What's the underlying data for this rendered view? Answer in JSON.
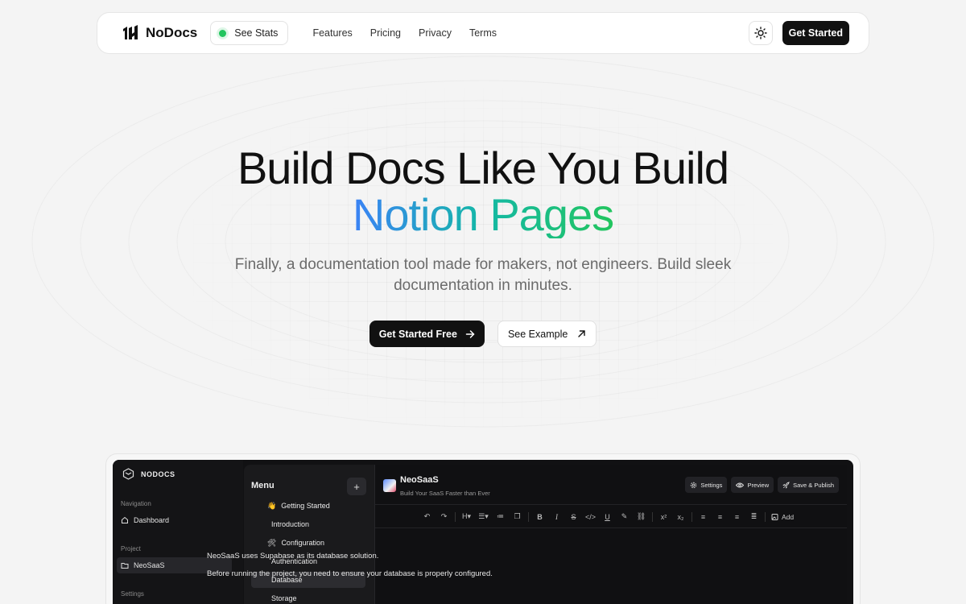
{
  "nav": {
    "brand": "NoDocs",
    "stats_label": "See Stats",
    "links": [
      "Features",
      "Pricing",
      "Privacy",
      "Terms"
    ],
    "cta": "Get Started"
  },
  "hero": {
    "title_line1": "Build Docs Like You Build",
    "title_line2": "Notion Pages",
    "subtitle": "Finally, a documentation tool made for makers, not engineers. Build sleek documentation in minutes.",
    "primary_cta": "Get Started Free",
    "secondary_cta": "See Example"
  },
  "app": {
    "brand": "NODOCS",
    "sidebar": {
      "navigation_label": "Navigation",
      "dashboard": "Dashboard",
      "project_label": "Project",
      "project": "NeoSaaS",
      "settings_label": "Settings"
    },
    "menu": {
      "title": "Menu",
      "add": "+",
      "items": {
        "getting_started": "Getting Started",
        "introduction": "Introduction",
        "configuration": "Configuration",
        "authentication": "Authentication",
        "database": "Database",
        "storage": "Storage"
      },
      "emoji_wave": "👋",
      "emoji_tools": "🛠"
    },
    "editor": {
      "doc_title": "NeoSaaS",
      "doc_subtitle": "Build Your SaaS Faster than Ever",
      "settings": "Settings",
      "preview": "Preview",
      "publish": "Save & Publish",
      "toolbar_add": "Add",
      "paragraph1": "NeoSaaS uses Supabase as its database solution.",
      "paragraph2": "Before running the project, you need to ensure your database is properly configured."
    }
  },
  "colors": {
    "accent_green": "#22c55e",
    "gradient_start": "#3b82f6",
    "gradient_end": "#22c55e"
  }
}
